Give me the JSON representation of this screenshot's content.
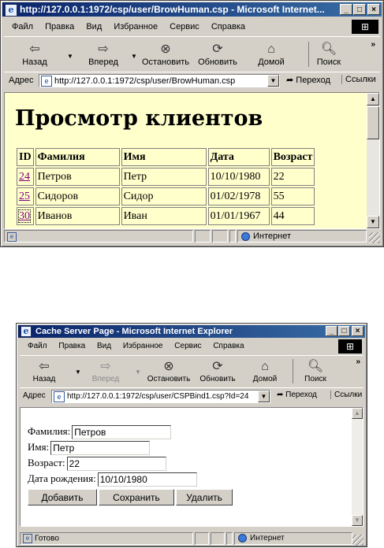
{
  "window1": {
    "title": "http://127.0.0.1:1972/csp/user/BrowHuman.csp - Microsoft Internet...",
    "menu": [
      "Файл",
      "Правка",
      "Вид",
      "Избранное",
      "Сервис",
      "Справка"
    ],
    "toolbar": {
      "back": "Назад",
      "forward": "Вперед",
      "stop": "Остановить",
      "refresh": "Обновить",
      "home": "Домой",
      "search": "Поиск"
    },
    "address_label": "Адрес",
    "address_url": "http://127.0.0.1:1972/csp/user/BrowHuman.csp",
    "go_label": "Переход",
    "links_label": "Ссылки",
    "page": {
      "heading": "Просмотр клиентов",
      "columns": [
        "ID",
        "Фамилия",
        "Имя",
        "Дата",
        "Возраст"
      ],
      "rows": [
        [
          "24",
          "Петров",
          "Петр",
          "10/10/1980",
          "22"
        ],
        [
          "25",
          "Сидоров",
          "Сидор",
          "01/02/1978",
          "55"
        ],
        [
          "30",
          "Иванов",
          "Иван",
          "01/01/1967",
          "44"
        ]
      ]
    },
    "status": {
      "zone": "Интернет"
    }
  },
  "window2": {
    "title": "Cache Server Page - Microsoft Internet Explorer",
    "menu": [
      "Файл",
      "Правка",
      "Вид",
      "Избранное",
      "Сервис",
      "Справка"
    ],
    "toolbar": {
      "back": "Назад",
      "forward": "Вперед",
      "stop": "Остановить",
      "refresh": "Обновить",
      "home": "Домой",
      "search": "Поиск"
    },
    "address_label": "Адрес",
    "address_url": "http://127.0.0.1:1972/csp/user/CSPBind1.csp?Id=24",
    "go_label": "Переход",
    "links_label": "Ссылки",
    "form": {
      "lastname_label": "Фамилия:",
      "lastname_value": "Петров",
      "firstname_label": "Имя:",
      "firstname_value": "Петр",
      "age_label": "Возраст:",
      "age_value": "22",
      "dob_label": "Дата рождения:",
      "dob_value": "10/10/1980",
      "add_button": "Добавить",
      "save_button": "Сохранить",
      "delete_button": "Удалить"
    },
    "status": {
      "text": "Готово",
      "zone": "Интернет"
    }
  }
}
